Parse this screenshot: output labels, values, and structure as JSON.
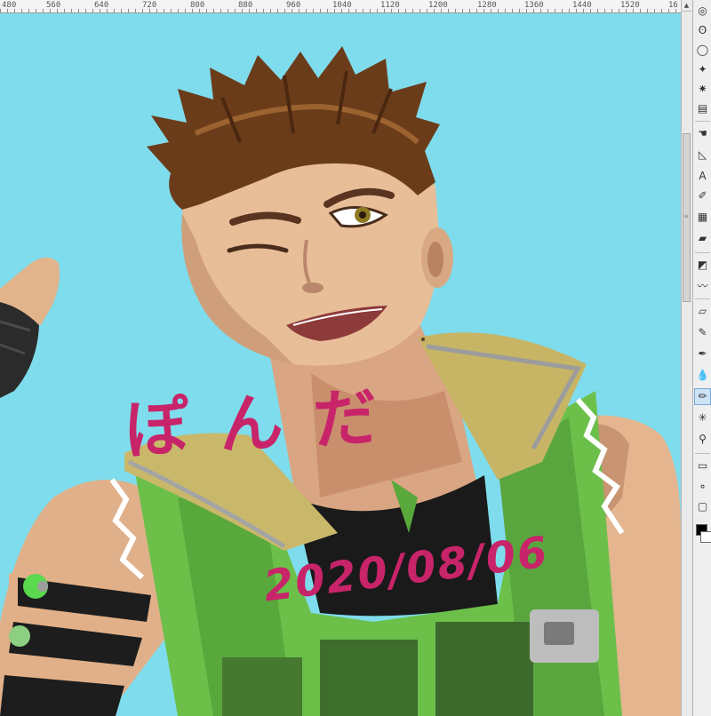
{
  "ruler": {
    "labels": [
      "480",
      "560",
      "640",
      "720",
      "800",
      "880",
      "960",
      "1040",
      "1120",
      "1200",
      "1280",
      "1360",
      "1440",
      "1520",
      "16"
    ]
  },
  "canvas": {
    "background_color": "#7fdcec",
    "caption_name": "ぽんだ",
    "caption_date": "2020/08/06",
    "caption_color": "#c8246a"
  },
  "scrollbar": {
    "up_arrow": "▲",
    "grip": "≡"
  },
  "toolbar": {
    "tools": [
      {
        "icon": "ring-icon",
        "glyph": "◎",
        "active": false
      },
      {
        "icon": "lasso-icon",
        "glyph": "ʘ",
        "active": false
      },
      {
        "icon": "ellipse-icon",
        "glyph": "◯",
        "active": false
      },
      {
        "icon": "sparkle-icon",
        "glyph": "✦",
        "active": false
      },
      {
        "icon": "star-icon",
        "glyph": "✷",
        "active": false
      },
      {
        "icon": "layers-icon",
        "glyph": "▤",
        "active": false
      },
      {
        "icon": "hand-icon",
        "glyph": "☚",
        "active": false
      },
      {
        "icon": "ruler-icon",
        "glyph": "◺",
        "active": false
      },
      {
        "icon": "text-icon",
        "glyph": "A",
        "active": false
      },
      {
        "icon": "balloon-icon",
        "glyph": "✐",
        "active": false
      },
      {
        "icon": "grid-icon",
        "glyph": "▦",
        "active": false
      },
      {
        "icon": "fill-icon",
        "glyph": "▰",
        "active": false
      },
      {
        "icon": "gradient-icon",
        "glyph": "◩",
        "active": false
      },
      {
        "icon": "brush-icon",
        "glyph": "〰",
        "active": false
      },
      {
        "icon": "eraser-icon",
        "glyph": "▱",
        "active": false
      },
      {
        "icon": "pen-icon",
        "glyph": "✎",
        "active": false
      },
      {
        "icon": "marker-icon",
        "glyph": "✒",
        "active": false
      },
      {
        "icon": "blend-icon",
        "glyph": "💧",
        "active": false
      },
      {
        "icon": "pencil-icon",
        "glyph": "✏",
        "active": true
      },
      {
        "icon": "airbrush-icon",
        "glyph": "✳",
        "active": false
      },
      {
        "icon": "dropper-icon",
        "glyph": "⚲",
        "active": false
      },
      {
        "icon": "figure-icon",
        "glyph": "▭",
        "active": false
      },
      {
        "icon": "picker-icon",
        "glyph": "⚬",
        "active": false
      },
      {
        "icon": "frame-icon",
        "glyph": "▢",
        "active": false
      }
    ],
    "colors": {
      "main": "#000000",
      "sub": "#ffffff",
      "accent_green": "#22cc22"
    }
  }
}
